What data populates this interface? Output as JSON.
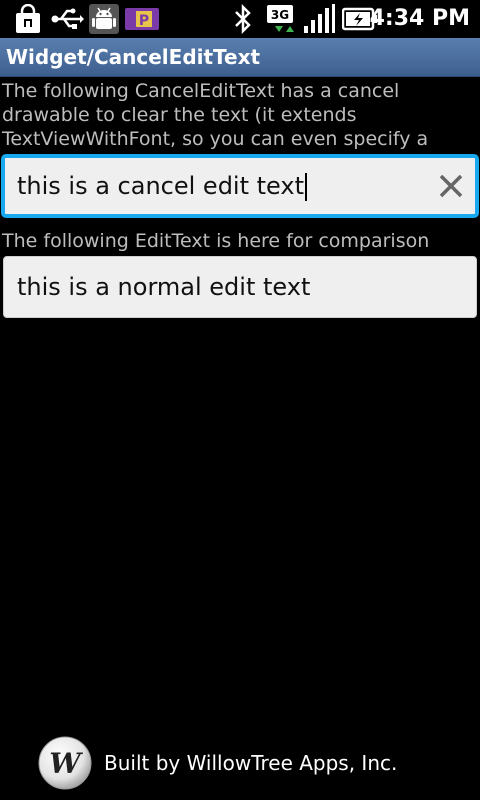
{
  "status_bar": {
    "time": "4:34 PM",
    "network": "3G",
    "icons": [
      "shopping-bag-icon",
      "usb-icon",
      "android-debug-icon",
      "parking-app-icon",
      "bluetooth-icon",
      "network-3g-icon",
      "signal-bars-icon",
      "battery-charging-icon"
    ]
  },
  "title_bar": {
    "title": "Widget/CancelEditText"
  },
  "main": {
    "description_cancel": "The following CancelEditText has a cancel drawable to clear the text (it extends TextViewWithFont, so you can even specify a custom font if you like)",
    "cancel_edit_text_value": "this is a cancel edit text",
    "description_normal": "The following EditText is here for comparison",
    "normal_edit_text_value": "this is a normal edit text"
  },
  "footer": {
    "logo_letter": "W",
    "text": "Built by WillowTree Apps, Inc."
  },
  "colors": {
    "focus_border": "#18a8f0",
    "title_bar": "#4a6d9e"
  }
}
